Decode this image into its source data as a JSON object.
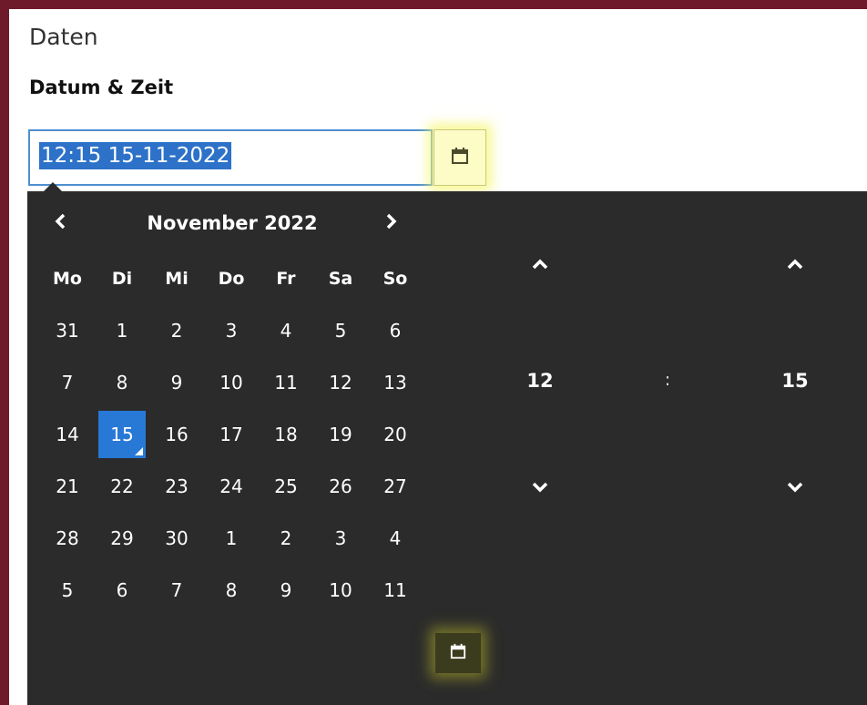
{
  "section": {
    "title": "Daten"
  },
  "field": {
    "label": "Datum & Zeit",
    "value": "12:15 15-11-2022"
  },
  "picker": {
    "month_title": "November 2022",
    "weekdays": [
      "Mo",
      "Di",
      "Mi",
      "Do",
      "Fr",
      "Sa",
      "So"
    ],
    "weeks": [
      [
        {
          "d": "31",
          "o": true
        },
        {
          "d": "1"
        },
        {
          "d": "2"
        },
        {
          "d": "3"
        },
        {
          "d": "4"
        },
        {
          "d": "5"
        },
        {
          "d": "6"
        }
      ],
      [
        {
          "d": "7"
        },
        {
          "d": "8"
        },
        {
          "d": "9"
        },
        {
          "d": "10"
        },
        {
          "d": "11"
        },
        {
          "d": "12"
        },
        {
          "d": "13"
        }
      ],
      [
        {
          "d": "14"
        },
        {
          "d": "15",
          "sel": true
        },
        {
          "d": "16"
        },
        {
          "d": "17"
        },
        {
          "d": "18"
        },
        {
          "d": "19"
        },
        {
          "d": "20"
        }
      ],
      [
        {
          "d": "21"
        },
        {
          "d": "22"
        },
        {
          "d": "23"
        },
        {
          "d": "24"
        },
        {
          "d": "25"
        },
        {
          "d": "26"
        },
        {
          "d": "27"
        }
      ],
      [
        {
          "d": "28"
        },
        {
          "d": "29"
        },
        {
          "d": "30"
        },
        {
          "d": "1",
          "o": true
        },
        {
          "d": "2",
          "o": true
        },
        {
          "d": "3",
          "o": true
        },
        {
          "d": "4",
          "o": true
        }
      ],
      [
        {
          "d": "5",
          "o": true
        },
        {
          "d": "6",
          "o": true
        },
        {
          "d": "7",
          "o": true
        },
        {
          "d": "8",
          "o": true
        },
        {
          "d": "9",
          "o": true
        },
        {
          "d": "10",
          "o": true
        },
        {
          "d": "11",
          "o": true
        }
      ]
    ],
    "hour": "12",
    "separator": ":",
    "minute": "15"
  },
  "colors": {
    "frame": "#6f1a2a",
    "picker_bg": "#2b2b2b",
    "selected_day": "#2878d6",
    "highlight": "#fdfbc6"
  },
  "icons": {
    "calendar": "calendar-icon",
    "prev": "chevron-left-icon",
    "next": "chevron-right-icon",
    "up": "chevron-up-icon",
    "down": "chevron-down-icon"
  }
}
